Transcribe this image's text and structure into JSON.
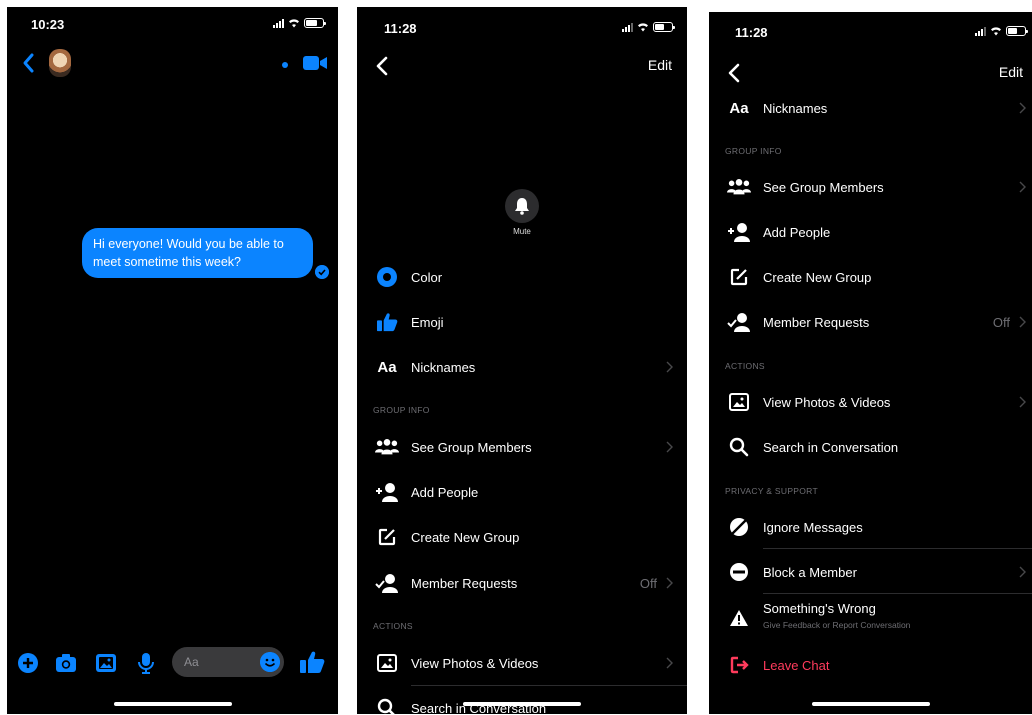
{
  "screen1": {
    "time": "10:23",
    "message": "Hi everyone! Would you be able to meet sometime this week?",
    "composer_placeholder": "Aa"
  },
  "screen2": {
    "time": "11:28",
    "edit_label": "Edit",
    "mute_label": "Mute",
    "items": [
      {
        "label": "Color",
        "icon": "color-icon"
      },
      {
        "label": "Emoji",
        "icon": "thumbs-up-icon"
      },
      {
        "label": "Nicknames",
        "icon": "aa-icon"
      }
    ],
    "section_group_info": "GROUP INFO",
    "group_items": [
      {
        "label": "See Group Members",
        "icon": "group-members-icon"
      },
      {
        "label": "Add People",
        "icon": "add-person-icon"
      },
      {
        "label": "Create New Group",
        "icon": "create-group-icon"
      },
      {
        "label": "Member Requests",
        "icon": "member-requests-icon",
        "value": "Off"
      }
    ],
    "section_actions": "ACTIONS",
    "action_items": [
      {
        "label": "View Photos & Videos",
        "icon": "photo-icon"
      },
      {
        "label": "Search in Conversation",
        "icon": "search-icon"
      }
    ]
  },
  "screen3": {
    "time": "11:28",
    "edit_label": "Edit",
    "nicknames_label": "Nicknames",
    "section_group_info": "GROUP INFO",
    "group_items": [
      {
        "label": "See Group Members"
      },
      {
        "label": "Add People"
      },
      {
        "label": "Create New Group"
      },
      {
        "label": "Member Requests",
        "value": "Off"
      }
    ],
    "section_actions": "ACTIONS",
    "action_items": [
      {
        "label": "View Photos & Videos"
      },
      {
        "label": "Search in Conversation"
      }
    ],
    "section_privacy": "PRIVACY & SUPPORT",
    "privacy_items": [
      {
        "label": "Ignore Messages"
      },
      {
        "label": "Block a Member"
      },
      {
        "label": "Something's Wrong",
        "subtitle": "Give Feedback or Report Conversation"
      },
      {
        "label": "Leave Chat"
      }
    ]
  },
  "colors": {
    "accent": "#0b84ff",
    "danger": "#ff3b5c",
    "background": "#000000",
    "muted_text": "#6e6e73"
  }
}
